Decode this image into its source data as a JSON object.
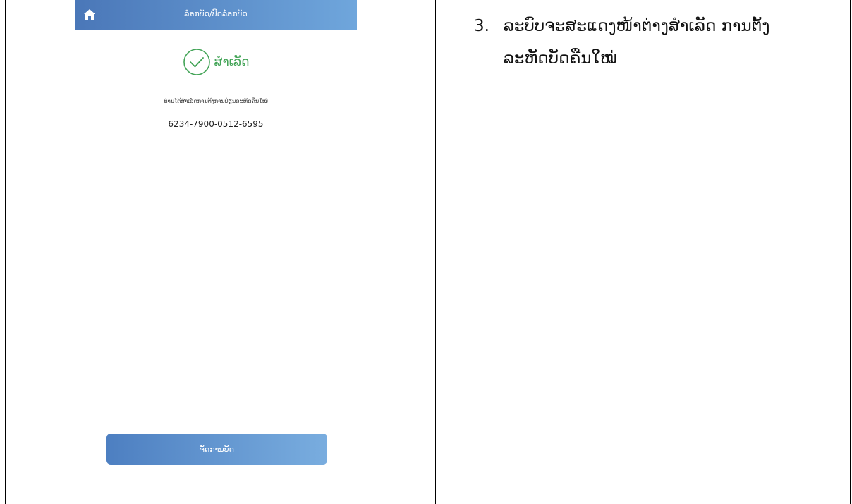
{
  "phone": {
    "nav_title": "ລ໋ອກບັດ/ປົດລ໋ອກບັດ",
    "success_label": "ສຳເລັດ",
    "message": "ທ່ານໄດ້ສຳເລັດການຕັ້ງການປ່ຽນລະຫັດຄືນໃໝ່",
    "card_number": "6234-7900-0512-6595",
    "button_label": "ຈັດການບັດ",
    "icons": {
      "home": "home-icon",
      "success": "check-circle-icon"
    },
    "colors": {
      "nav_start": "#4a77b8",
      "nav_end": "#6fa6dc",
      "success": "#43a457"
    }
  },
  "instruction": {
    "number": "3.",
    "line1": "ລະບົບຈະສະແດງໜ້າຕ່າງສຳເລັດ ການຕັ້ງ",
    "line2": "ລະຫັດບັດຄືນໃໝ່"
  }
}
